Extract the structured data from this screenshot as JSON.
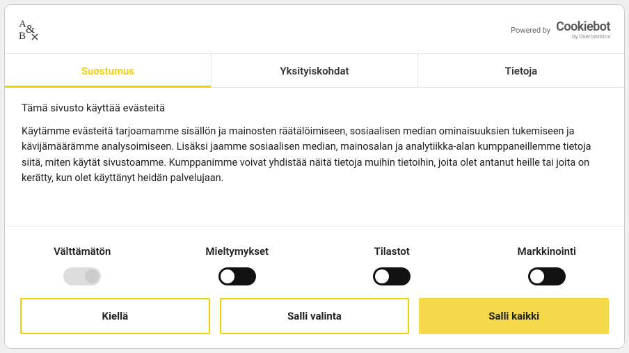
{
  "header": {
    "logo": "A&\nB",
    "powered_label": "Powered by",
    "brand": "Cookiebot",
    "brand_sub": "by Usercentrics"
  },
  "tabs": [
    {
      "label": "Suostumus",
      "active": true
    },
    {
      "label": "Yksityiskohdat",
      "active": false
    },
    {
      "label": "Tietoja",
      "active": false
    }
  ],
  "content": {
    "title": "Tämä sivusto käyttää evästeitä",
    "body": "Käytämme evästeitä tarjoamamme sisällön ja mainosten räätälöimiseen, sosiaalisen median ominaisuuksien tukemiseen ja kävijämäärämme analysoimiseen. Lisäksi jaamme sosiaalisen median, mainosalan ja analytiikka-alan kumppaneillemme tietoja siitä, miten käytät sivustoamme. Kumppanimme voivat yhdistää näitä tietoja muihin tietoihin, joita olet antanut heille tai joita on kerätty, kun olet käyttänyt heidän palvelujaan."
  },
  "categories": [
    {
      "label": "Välttämätön",
      "state": "disabled"
    },
    {
      "label": "Mieltymykset",
      "state": "off"
    },
    {
      "label": "Tilastot",
      "state": "off"
    },
    {
      "label": "Markkinointi",
      "state": "off"
    }
  ],
  "actions": {
    "deny": "Kiellä",
    "allow_selection": "Salli valinta",
    "allow_all": "Salli kaikki"
  }
}
